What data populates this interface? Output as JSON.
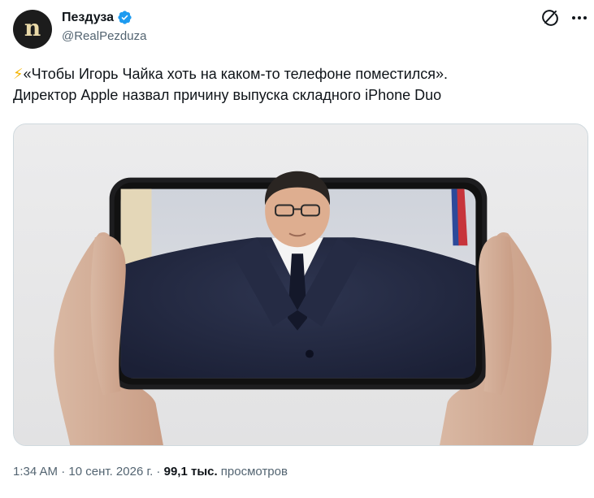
{
  "author": {
    "avatar_letter": "n",
    "name": "Пездуза",
    "handle": "@RealPezduza",
    "verified_color": "#1d9bf0"
  },
  "actions": {
    "grok_icon": "grok-icon",
    "more_icon": "more-icon"
  },
  "tweet": {
    "line1_emoji": "⚡",
    "line1_text": "«Чтобы Игорь Чайка хоть на каком-то телефоне поместился».",
    "line2_text": "Директор Apple назвал причину выпуска складного iPhone Duo"
  },
  "meta": {
    "time": "1:34 AM",
    "sep1": " · ",
    "date": "10 сент. 2026 г.",
    "sep2": " · ",
    "views_count": "99,1 тыс.",
    "views_label": " просмотров"
  },
  "colors": {
    "text": "#0f1419",
    "secondary": "#536471",
    "accent": "#1d9bf0",
    "border": "#cfd9de"
  }
}
